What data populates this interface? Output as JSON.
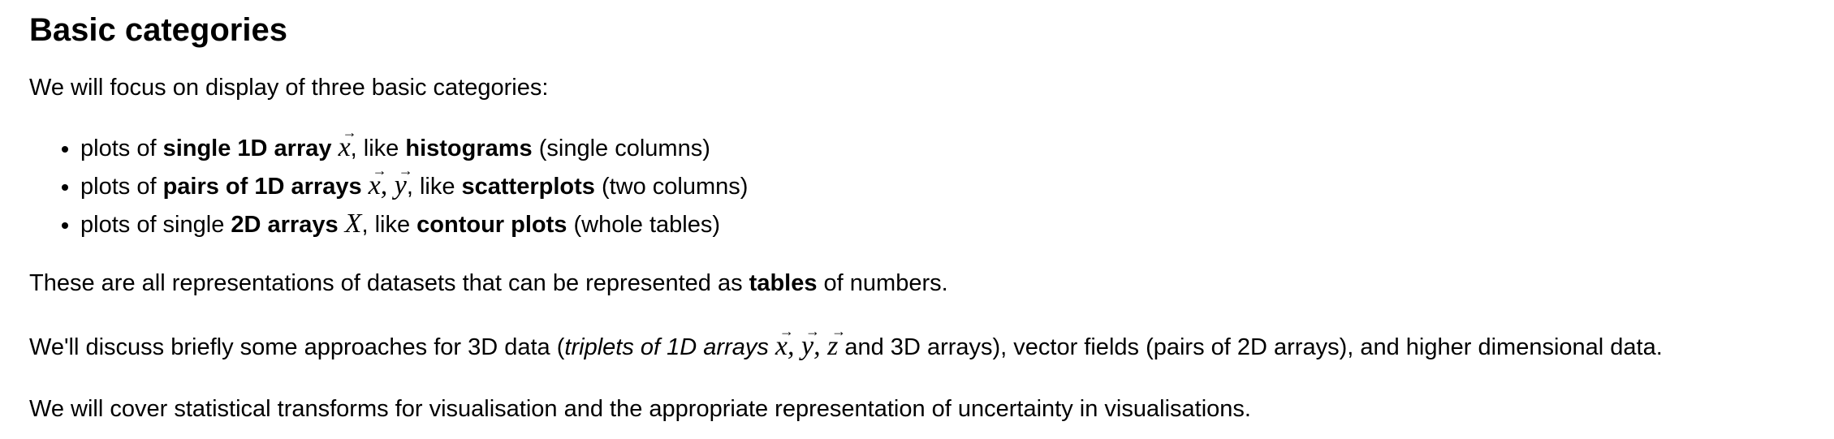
{
  "title": "Basic categories",
  "intro": "We will focus on display of three basic categories:",
  "items": [
    {
      "pre": "plots of ",
      "bold1": "single 1D array",
      "math": [
        "x"
      ],
      "mid": ", like ",
      "bold2": "histograms",
      "post": " (single columns)"
    },
    {
      "pre": "plots of ",
      "bold1": "pairs of 1D arrays",
      "math": [
        "x",
        "y"
      ],
      "mid": ", like ",
      "bold2": "scatterplots",
      "post": " (two columns)"
    },
    {
      "pre": "plots of single ",
      "bold1": "2D arrays",
      "math": [
        "X"
      ],
      "mid": ", like ",
      "bold2": "contour plots",
      "post": " (whole tables)"
    }
  ],
  "tables_para": {
    "pre": "These are all representations of datasets that can be represented as ",
    "bold": "tables",
    "post": " of numbers."
  },
  "data3d_para": {
    "pre": "We'll discuss briefly some approaches for 3D data (",
    "italic": "triplets of 1D arrays",
    "math": [
      "x",
      "y",
      "z"
    ],
    "post": " and 3D arrays), vector fields (pairs of 2D arrays), and higher dimensional data."
  },
  "stats_para": "We will cover statistical transforms for visualisation and the appropriate representation of uncertainty in visualisations."
}
